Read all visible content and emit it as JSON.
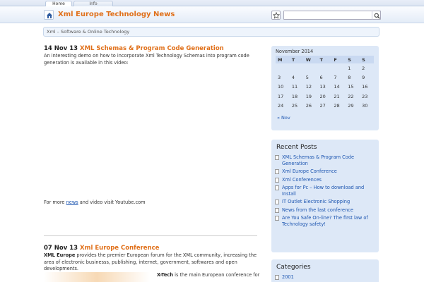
{
  "nav": {
    "tabs": [
      "Home",
      "Info"
    ]
  },
  "header": {
    "title": "Xml Europe Technology News"
  },
  "breadcrumb": "Xml – Software & Online Technology",
  "posts": [
    {
      "date": "14 Nov 13",
      "title": "XML Schemas & Program Code Generation",
      "body": "An interesting demo on how to incorporate Xml Technology Schemas into program code generation is available in this video:",
      "footer_pre": "For more ",
      "footer_link": "news",
      "footer_post": " and video visit Youtube.com"
    },
    {
      "date": "07 Nov 13",
      "title": "Xml Europe Conference",
      "lead_bold": "XML Europe",
      "body": " provides the premier European forum for the XML community, increasing the area of electronic businesss, publishing, internet, government, softwares and open developments.",
      "sub_bold": "X-Tech",
      "sub_body": " is the main European conference for"
    }
  ],
  "calendar": {
    "month": "November 2014",
    "days": [
      "M",
      "T",
      "W",
      "T",
      "F",
      "S",
      "S"
    ],
    "weeks": [
      [
        "",
        "",
        "",
        "",
        "",
        "1",
        "2"
      ],
      [
        "3",
        "4",
        "5",
        "6",
        "7",
        "8",
        "9"
      ],
      [
        "10",
        "11",
        "12",
        "13",
        "14",
        "15",
        "16"
      ],
      [
        "17",
        "18",
        "19",
        "20",
        "21",
        "22",
        "23"
      ],
      [
        "24",
        "25",
        "26",
        "27",
        "28",
        "29",
        "30"
      ]
    ],
    "prev": "« Nov"
  },
  "recent_posts": {
    "title": "Recent Posts",
    "items": [
      "XML Schemas & Program Code Generation",
      "Xml Europe Conference",
      "Xml Conferences",
      "Apps for Pc – How to download and Install",
      "IT Outlet Electronic Shopping",
      "News from the last conference",
      "Are You Safe On-line? The first law of Technology safety!"
    ]
  },
  "categories": {
    "title": "Categories",
    "items": [
      "2001"
    ]
  }
}
